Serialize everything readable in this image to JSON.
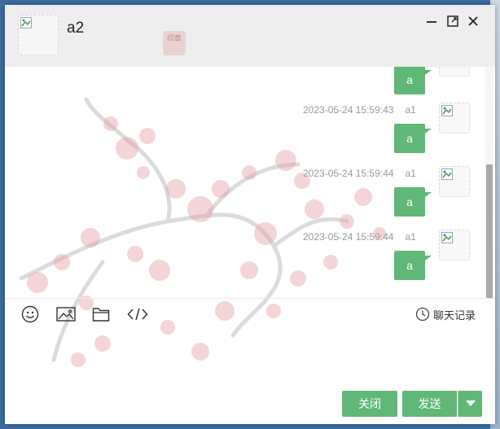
{
  "header": {
    "contact_name": "a2",
    "seal_text": "印章"
  },
  "messages": [
    {
      "time": "",
      "sender": "",
      "text": "a"
    },
    {
      "time": "2023-05-24 15:59:43",
      "sender": "a1",
      "text": "a"
    },
    {
      "time": "2023-05-24 15:59:44",
      "sender": "a1",
      "text": "a"
    },
    {
      "time": "2023-05-24 15:59:44",
      "sender": "a1",
      "text": "a"
    }
  ],
  "toolbar": {
    "emoji_icon": "smiley-icon",
    "image_icon": "image-icon",
    "file_icon": "folder-icon",
    "code_icon": "code-icon",
    "history_label": "聊天记录"
  },
  "buttons": {
    "close_label": "关闭",
    "send_label": "发送"
  },
  "colors": {
    "accent": "#5fb878",
    "titlebar": "#eeeeee"
  }
}
